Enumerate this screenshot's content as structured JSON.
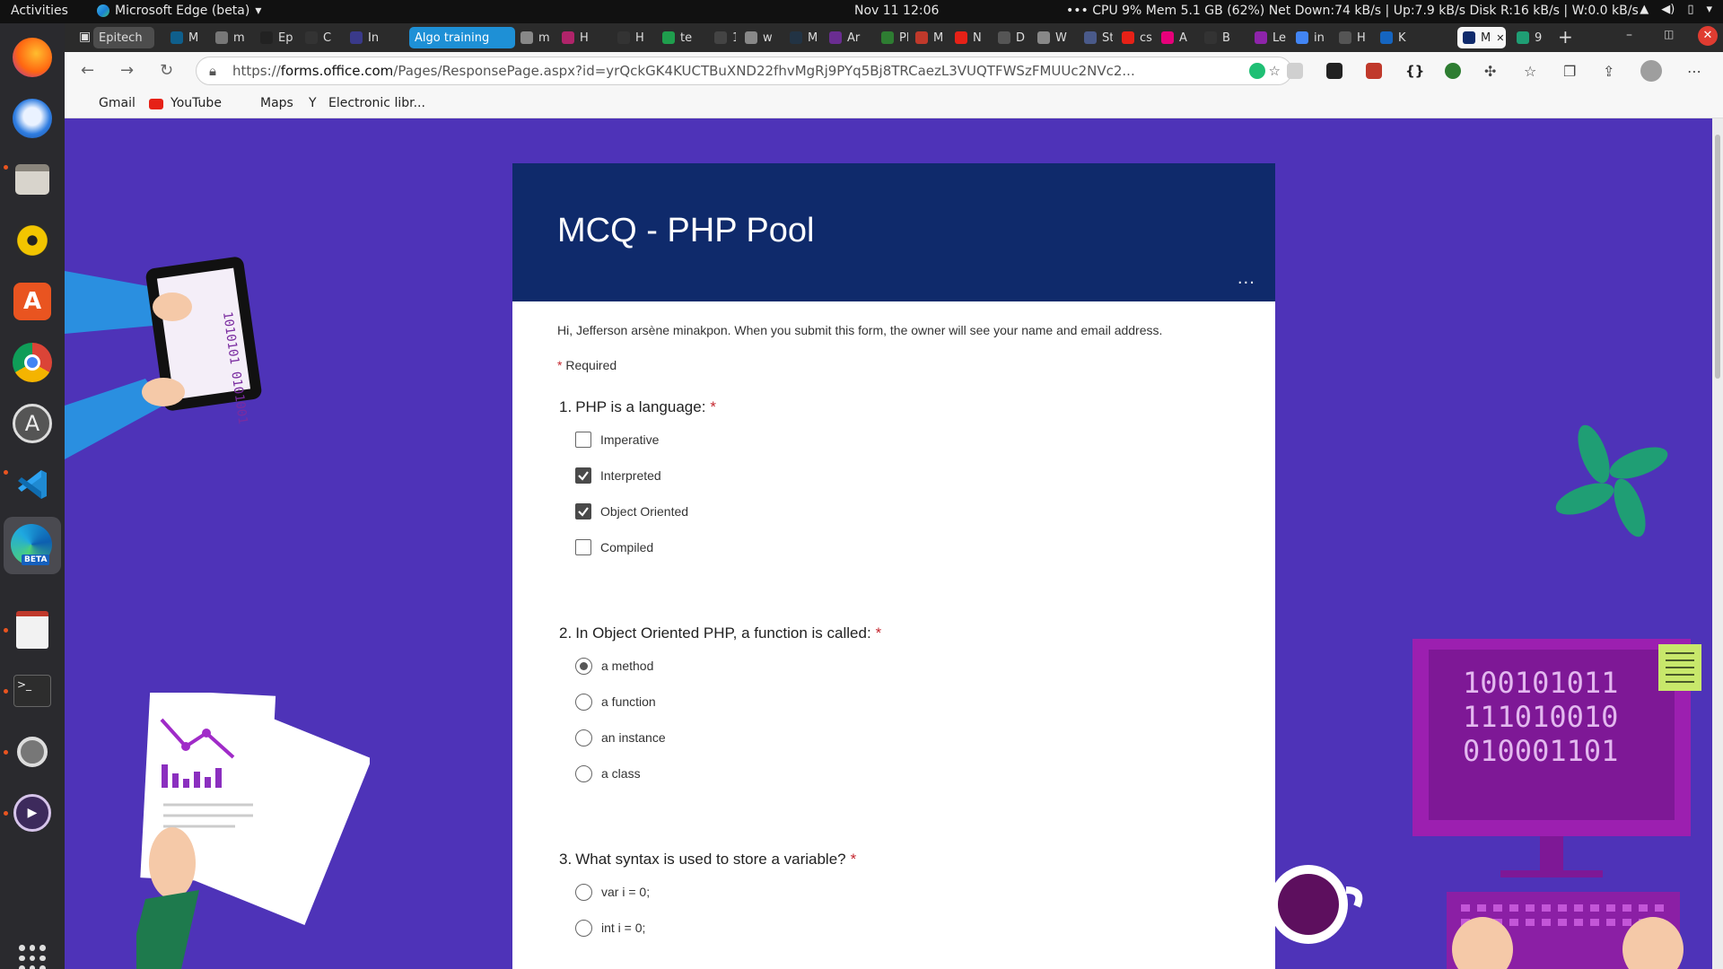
{
  "topbar": {
    "activities": "Activities",
    "app_name": "Microsoft Edge (beta)",
    "clock": "Nov 11  12:06",
    "stats": "••• CPU 9%   Mem 5.1 GB (62%)   Net Down:74 kB/s | Up:7.9 kB/s   Disk R:16 kB/s | W:0.0 kB/s"
  },
  "tabs": [
    {
      "label": "Epitech",
      "color": "#3a3a3a"
    },
    {
      "label": "M",
      "color": "#0f5f8c"
    },
    {
      "label": "m",
      "color": "#777"
    },
    {
      "label": "Ep",
      "color": "#222"
    },
    {
      "label": "C",
      "color": "#333"
    },
    {
      "label": "In",
      "color": "#3a3a8a"
    },
    {
      "label": "Algo training",
      "color": "#1e90d6"
    },
    {
      "label": "m",
      "color": "#888"
    },
    {
      "label": "H",
      "color": "#b0246a"
    },
    {
      "label": "H",
      "color": "#333"
    },
    {
      "label": "te",
      "color": "#1f9e4d"
    },
    {
      "label": "12",
      "color": "#444"
    },
    {
      "label": "w",
      "color": "#888"
    },
    {
      "label": "M",
      "color": "#234"
    },
    {
      "label": "Ar",
      "color": "#6a2d91"
    },
    {
      "label": "PI",
      "color": "#2e7d32"
    },
    {
      "label": "M",
      "color": "#c0392b"
    },
    {
      "label": "N",
      "color": "#e62117"
    },
    {
      "label": "D",
      "color": "#555"
    },
    {
      "label": "W",
      "color": "#888"
    },
    {
      "label": "St",
      "color": "#4a5a8a"
    },
    {
      "label": "cs",
      "color": "#e62117"
    },
    {
      "label": "A",
      "color": "#e6007a"
    },
    {
      "label": "B",
      "color": "#333"
    },
    {
      "label": "Le",
      "color": "#8e24aa"
    },
    {
      "label": "in",
      "color": "#4285f4"
    },
    {
      "label": "H",
      "color": "#555"
    },
    {
      "label": "K",
      "color": "#1565c0"
    },
    {
      "label": "M",
      "color": "#0f2a6b"
    },
    {
      "label": "9",
      "color": "#1f9e74"
    }
  ],
  "address": {
    "prefix": "https://",
    "host": "forms.office.com",
    "rest": "/Pages/ResponsePage.aspx?id=yrQckGK4KUCTBuXND22fhvMgRj9PYq5Bj8TRCaezL3VUQTFWSzFMUUc2NVc2..."
  },
  "bookmarks": {
    "gmail": "Gmail",
    "youtube": "YouTube",
    "maps": "Maps",
    "electronic": "Electronic libr..."
  },
  "form": {
    "title": "MCQ - PHP Pool",
    "more": "...",
    "notice": "Hi, Jefferson arsène minakpon. When you submit this form, the owner will see your name and email address.",
    "required_star": "*",
    "required_label": "Required",
    "questions": [
      {
        "number": "1.",
        "text": "PHP is a language:",
        "type": "checkbox",
        "options": [
          {
            "label": "Imperative",
            "checked": false
          },
          {
            "label": "Interpreted",
            "checked": true
          },
          {
            "label": "Object Oriented",
            "checked": true
          },
          {
            "label": "Compiled",
            "checked": false
          }
        ]
      },
      {
        "number": "2.",
        "text": "In Object Oriented PHP, a function is called:",
        "type": "radio",
        "options": [
          {
            "label": "a method",
            "checked": true
          },
          {
            "label": "a function",
            "checked": false
          },
          {
            "label": "an instance",
            "checked": false
          },
          {
            "label": "a class",
            "checked": false
          }
        ]
      },
      {
        "number": "3.",
        "text": "What syntax is used to store a variable?",
        "type": "radio",
        "options": [
          {
            "label": "var i = 0;",
            "checked": false
          },
          {
            "label": "int i = 0;",
            "checked": false
          }
        ]
      }
    ]
  },
  "decor": {
    "binary_left": "10101\n10101",
    "binary_monitor": "100101011\n111010010\n010001101"
  },
  "colors": {
    "page_bg": "#4e33b8",
    "header_bg": "#0f2a6b",
    "required": "#c4262e"
  }
}
